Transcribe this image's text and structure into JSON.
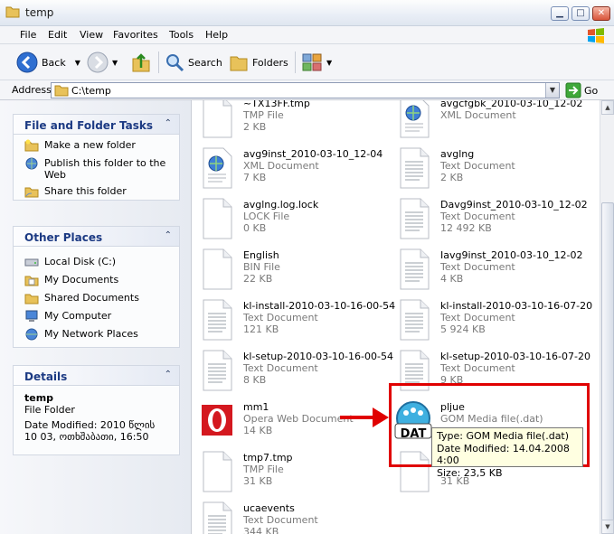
{
  "window": {
    "title": "temp"
  },
  "menu": [
    "File",
    "Edit",
    "View",
    "Favorites",
    "Tools",
    "Help"
  ],
  "toolbar": {
    "back": "Back",
    "search": "Search",
    "folders": "Folders"
  },
  "address": {
    "label": "Address",
    "value": "C:\\temp",
    "go": "Go"
  },
  "tasks": {
    "title": "File and Folder Tasks",
    "items": [
      "Make a new folder",
      "Publish this folder to the Web",
      "Share this folder"
    ]
  },
  "places": {
    "title": "Other Places",
    "items": [
      "Local Disk (C:)",
      "My Documents",
      "Shared Documents",
      "My Computer",
      "My Network Places"
    ]
  },
  "details": {
    "title": "Details",
    "name": "temp",
    "kind": "File Folder",
    "modified": "Date Modified: 2010 წლის 10 03, ოთხშაბათი, 16:50"
  },
  "files": [
    {
      "name": "~TX13FF.tmp",
      "type": "TMP File",
      "size": "2 KB",
      "icon": "blank-file-icon"
    },
    {
      "name": "avgcfgbk_2010-03-10_12-02",
      "type": "XML Document",
      "size": "",
      "icon": "xml-document-icon"
    },
    {
      "name": "avg9inst_2010-03-10_12-04",
      "type": "XML Document",
      "size": "7 KB",
      "icon": "xml-document-icon"
    },
    {
      "name": "avglng",
      "type": "Text Document",
      "size": "2 KB",
      "icon": "text-document-icon"
    },
    {
      "name": "avglng.log.lock",
      "type": "LOCK File",
      "size": "0 KB",
      "icon": "blank-file-icon"
    },
    {
      "name": "Davg9inst_2010-03-10_12-02",
      "type": "Text Document",
      "size": "12 492 KB",
      "icon": "text-document-icon"
    },
    {
      "name": "English",
      "type": "BIN File",
      "size": "22 KB",
      "icon": "blank-file-icon"
    },
    {
      "name": "Iavg9inst_2010-03-10_12-02",
      "type": "Text Document",
      "size": "4 KB",
      "icon": "text-document-icon"
    },
    {
      "name": "kl-install-2010-03-10-16-00-54",
      "type": "Text Document",
      "size": "121 KB",
      "icon": "text-document-icon"
    },
    {
      "name": "kl-install-2010-03-10-16-07-20",
      "type": "Text Document",
      "size": "5 924 KB",
      "icon": "text-document-icon"
    },
    {
      "name": "kl-setup-2010-03-10-16-00-54",
      "type": "Text Document",
      "size": "8 KB",
      "icon": "text-document-icon"
    },
    {
      "name": "kl-setup-2010-03-10-16-07-20",
      "type": "Text Document",
      "size": "9 KB",
      "icon": "text-document-icon"
    },
    {
      "name": "mm1",
      "type": "Opera Web Document",
      "size": "14 KB",
      "icon": "opera-icon"
    },
    {
      "name": "pljue",
      "type": "GOM Media file(.dat)",
      "size": "",
      "icon": "gom-dat-icon"
    },
    {
      "name": "tmp7.tmp",
      "type": "TMP File",
      "size": "31 KB",
      "icon": "blank-file-icon"
    },
    {
      "name": "",
      "type": "",
      "size": "31 KB",
      "icon": "blank-file-icon"
    },
    {
      "name": "ucaevents",
      "type": "Text Document",
      "size": "344 KB",
      "icon": "text-document-icon"
    }
  ],
  "tooltip": {
    "type": "Type: GOM Media file(.dat)",
    "modified": "Date Modified: 14.04.2008 4:00",
    "size": "Size: 23,5 KB"
  },
  "gom_icon_label": "DAT",
  "colors": {
    "highlight_box": "#e00000",
    "panel_heading": "#1c3a83"
  }
}
